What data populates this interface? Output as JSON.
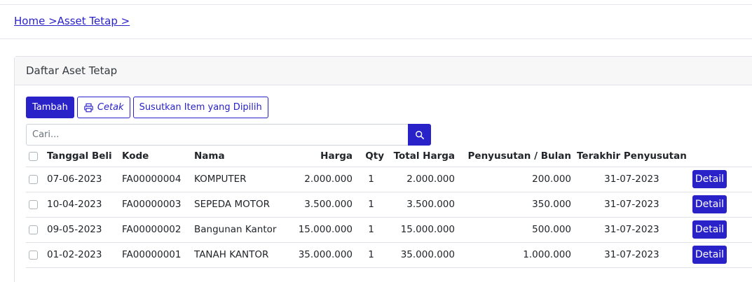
{
  "breadcrumb": {
    "home": "Home >",
    "asset": "Asset Tetap >"
  },
  "card": {
    "title": "Daftar Aset Tetap"
  },
  "toolbar": {
    "add_label": "Tambah",
    "print_label": "Cetak",
    "depreciate_label": "Susutkan Item yang Dipilih"
  },
  "search": {
    "placeholder": "Cari..."
  },
  "table": {
    "headers": {
      "date": "Tanggal Beli",
      "code": "Kode",
      "name": "Nama",
      "price": "Harga",
      "qty": "Qty",
      "total": "Total Harga",
      "depreciation": "Penyusutan / Bulan",
      "last": "Terakhir Penyusutan"
    },
    "rows": [
      {
        "date": "07-06-2023",
        "code": "FA00000004",
        "name": "KOMPUTER",
        "price": "2.000.000",
        "qty": "1",
        "total": "2.000.000",
        "depreciation": "200.000",
        "last": "31-07-2023",
        "action": "Detail"
      },
      {
        "date": "10-04-2023",
        "code": "FA00000003",
        "name": "SEPEDA MOTOR",
        "price": "3.500.000",
        "qty": "1",
        "total": "3.500.000",
        "depreciation": "350.000",
        "last": "31-07-2023",
        "action": "Detail"
      },
      {
        "date": "09-05-2023",
        "code": "FA00000002",
        "name": "Bangunan Kantor",
        "price": "15.000.000",
        "qty": "1",
        "total": "15.000.000",
        "depreciation": "500.000",
        "last": "31-07-2023",
        "action": "Detail"
      },
      {
        "date": "01-02-2023",
        "code": "FA00000001",
        "name": "TANAH KANTOR",
        "price": "35.000.000",
        "qty": "1",
        "total": "35.000.000",
        "depreciation": "1.000.000",
        "last": "31-07-2023",
        "action": "Detail"
      }
    ]
  },
  "icons": {
    "print": "printer-icon",
    "search": "search-icon"
  },
  "colors": {
    "primary": "#2a22c9"
  }
}
